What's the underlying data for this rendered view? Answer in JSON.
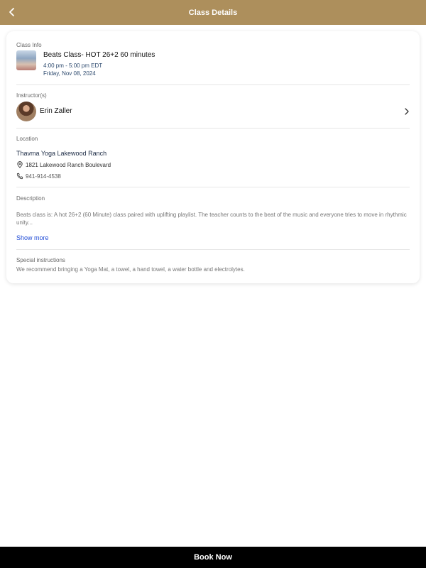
{
  "header": {
    "title": "Class Details",
    "back_icon": "back-chevron-icon"
  },
  "class_info": {
    "label": "Class Info",
    "title": "Beats Class- HOT 26+2 60 minutes",
    "time": "4:00 pm - 5:00 pm EDT",
    "date": "Friday, Nov 08, 2024"
  },
  "instructors": {
    "label": "Instructor(s)",
    "name": "Erin Zaller",
    "chevron_icon": "chevron-right-icon"
  },
  "location": {
    "label": "Location",
    "name": "Thavma Yoga Lakewood Ranch",
    "address": "1821 Lakewood Ranch Boulevard",
    "phone": "941-914-4538",
    "address_icon": "map-pin-icon",
    "phone_icon": "phone-icon"
  },
  "description": {
    "label": "Description",
    "text": "Beats class is: A hot 26+2 (60 Minute) class paired with  uplifting playlist. The teacher counts to the beat of the music and everyone tries to move in rhythmic unity...",
    "show_more": "Show more"
  },
  "special_instructions": {
    "label": "Special instructions",
    "text": "We recommend bringing a Yoga Mat, a towel, a hand towel, a water bottle and electrolytes."
  },
  "footer": {
    "book_label": "Book Now"
  },
  "colors": {
    "header_bg": "#ad8f5c",
    "link": "#1f4bd6",
    "footer_bg": "#000000"
  }
}
